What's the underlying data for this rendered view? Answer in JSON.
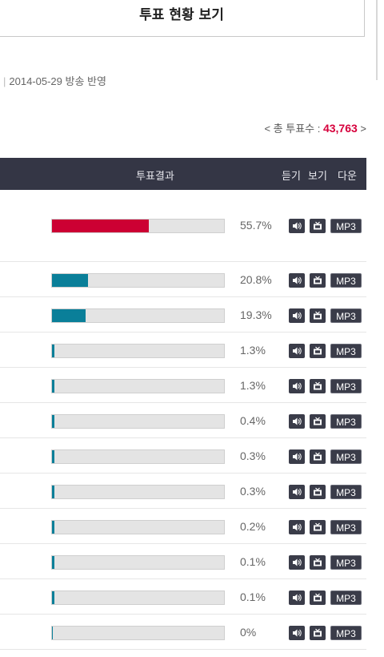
{
  "title": "투표 현황 보기",
  "broadcast": "2014-05-29 방송 반영",
  "total": {
    "prefix": "< 총 투표수 : ",
    "value": "43,763",
    "suffix": " >"
  },
  "header": {
    "result": "투표결과",
    "listen": "듣기",
    "watch": "보기",
    "download": "다운"
  },
  "colors": {
    "first": "#cc0033",
    "others": "#0a7f99"
  },
  "buttons": {
    "listen_icon": "speaker-icon",
    "watch_icon": "tv-icon",
    "mp3_label": "MP3"
  },
  "results": [
    {
      "percent": 55.7,
      "label": "55.7%"
    },
    {
      "percent": 20.8,
      "label": "20.8%"
    },
    {
      "percent": 19.3,
      "label": "19.3%"
    },
    {
      "percent": 1.3,
      "label": "1.3%"
    },
    {
      "percent": 1.3,
      "label": "1.3%"
    },
    {
      "percent": 0.4,
      "label": "0.4%"
    },
    {
      "percent": 0.3,
      "label": "0.3%"
    },
    {
      "percent": 0.3,
      "label": "0.3%"
    },
    {
      "percent": 0.2,
      "label": "0.2%"
    },
    {
      "percent": 0.1,
      "label": "0.1%"
    },
    {
      "percent": 0.1,
      "label": "0.1%"
    },
    {
      "percent": 0,
      "label": "0%"
    }
  ]
}
